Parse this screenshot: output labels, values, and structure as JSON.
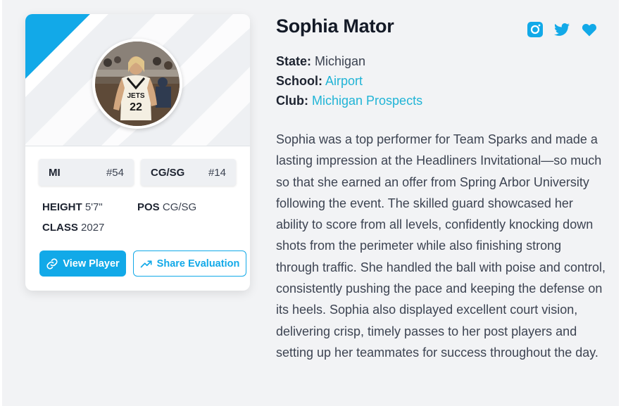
{
  "card": {
    "stats": [
      {
        "label": "MI",
        "value": "#54"
      },
      {
        "label": "CG/SG",
        "value": "#14"
      }
    ],
    "height_label": "HEIGHT",
    "height_value": "5'7\"",
    "pos_label": "POS",
    "pos_value": "CG/SG",
    "class_label": "CLASS",
    "class_value": "2027",
    "photo_jersey": "JETS",
    "photo_number": "22",
    "view_button": "View Player",
    "share_button": "Share Evaluation"
  },
  "player": {
    "name": "Sophia Mator",
    "state_label": "State:",
    "state_value": "Michigan",
    "school_label": "School:",
    "school_value": "Airport",
    "club_label": "Club:",
    "club_value": "Michigan Prospects",
    "bio": "Sophia was a top performer for Team Sparks and made a lasting impression at the Headliners Invitational—so much so that she earned an offer from Spring Arbor University following the event. The skilled guard showcased her ability to score from all levels, confidently knocking down shots from the perimeter while also finishing strong through traffic. She handled the ball with poise and control, consistently pushing the pace and keeping the defense on its heels. Sophia also displayed excellent court vision, delivering crisp, timely passes to her post players and setting up her teammates for success throughout the day."
  },
  "social": [
    "instagram-icon",
    "twitter-icon",
    "heart-icon"
  ],
  "colors": {
    "accent": "#12a9e8",
    "link": "#20b4d6",
    "text": "#141a27"
  }
}
